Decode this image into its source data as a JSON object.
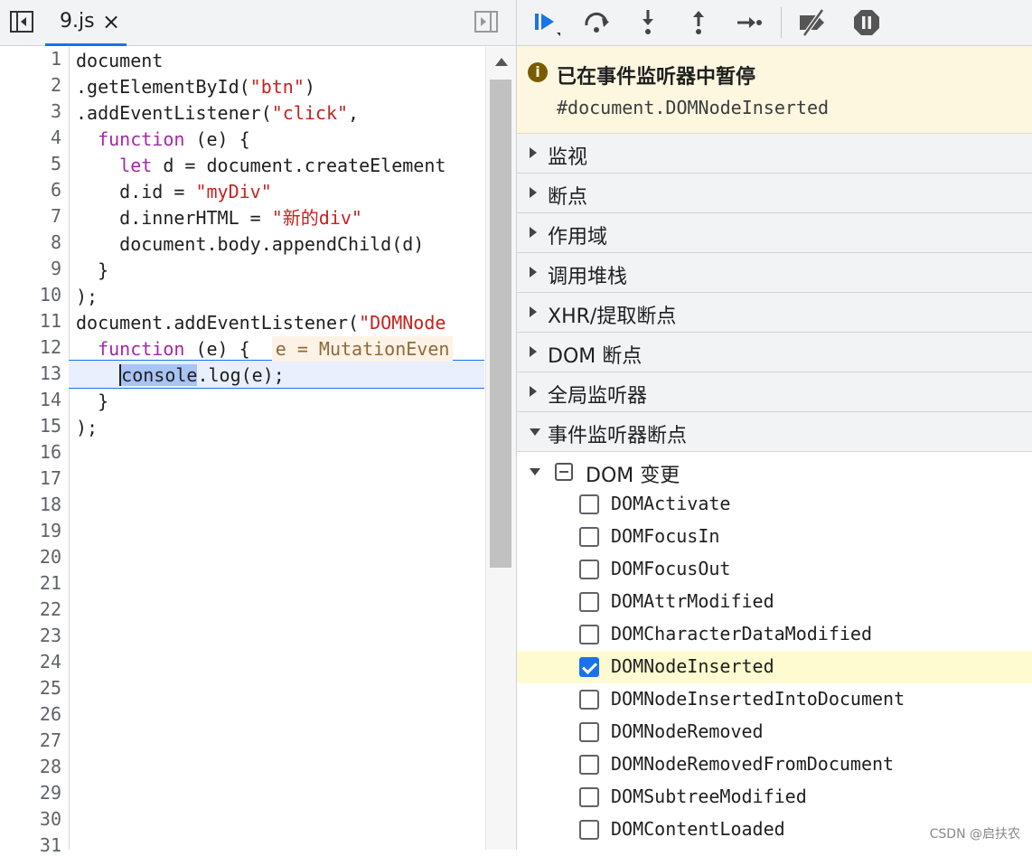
{
  "editor": {
    "tab": {
      "filename": "9.js",
      "close": "×"
    },
    "line_numbers": [
      "1",
      "2",
      "3",
      "4",
      "5",
      "6",
      "7",
      "8",
      "9",
      "10",
      "11",
      "12",
      "13",
      "14",
      "15",
      "16",
      "17",
      "18",
      "19",
      "20",
      "21",
      "22",
      "23",
      "24",
      "25",
      "26",
      "27",
      "28",
      "29",
      "30",
      "31"
    ],
    "code": {
      "l1": "document",
      "l2a": ".getElementById(",
      "l2b": "\"btn\"",
      "l2c": ")",
      "l3a": ".addEventListener(",
      "l3b": "\"click\"",
      "l3c": ",",
      "l4a": "  ",
      "l4b": "function",
      "l4c": " (e) {",
      "l5a": "    ",
      "l5b": "let",
      "l5c": " d = document.createElement",
      "l6a": "    d.id = ",
      "l6b": "\"myDiv\"",
      "l7a": "    d.innerHTML = ",
      "l7b": "\"新的div\"",
      "l8": "    document.body.appendChild(d)",
      "l9": "  }",
      "l10": ");",
      "l11a": "document.addEventListener(",
      "l11b": "\"DOMNode",
      "l12a": "  ",
      "l12b": "function",
      "l12c": " (e) {  ",
      "l12d": "e = MutationEven",
      "l13a": "    ",
      "l13b": "console",
      "l13c": ".log(e);",
      "l14": "  }",
      "l15": ");"
    }
  },
  "debugger": {
    "pause_title": "已在事件监听器中暂停",
    "pause_detail": "#document.DOMNodeInserted",
    "sections": [
      "监视",
      "断点",
      "作用域",
      "调用堆栈",
      "XHR/提取断点",
      "DOM 断点",
      "全局监听器"
    ],
    "expanded_section": "事件监听器断点",
    "group_label": "DOM 变更",
    "events": [
      {
        "label": "DOMActivate",
        "checked": false
      },
      {
        "label": "DOMFocusIn",
        "checked": false
      },
      {
        "label": "DOMFocusOut",
        "checked": false
      },
      {
        "label": "DOMAttrModified",
        "checked": false
      },
      {
        "label": "DOMCharacterDataModified",
        "checked": false
      },
      {
        "label": "DOMNodeInserted",
        "checked": true
      },
      {
        "label": "DOMNodeInsertedIntoDocument",
        "checked": false
      },
      {
        "label": "DOMNodeRemoved",
        "checked": false
      },
      {
        "label": "DOMNodeRemovedFromDocument",
        "checked": false
      },
      {
        "label": "DOMSubtreeModified",
        "checked": false
      },
      {
        "label": "DOMContentLoaded",
        "checked": false
      }
    ]
  },
  "toolbar_icons": [
    "resume-icon",
    "step-over-icon",
    "step-into-icon",
    "step-out-icon",
    "step-icon",
    "deactivate-breakpoints-icon",
    "pause-on-exceptions-icon"
  ],
  "watermark": "CSDN @启扶农",
  "colors": {
    "accent": "#1a73e8",
    "keyword": "#a626a4",
    "string": "#c5221f",
    "pause_banner": "#fef7e0"
  }
}
